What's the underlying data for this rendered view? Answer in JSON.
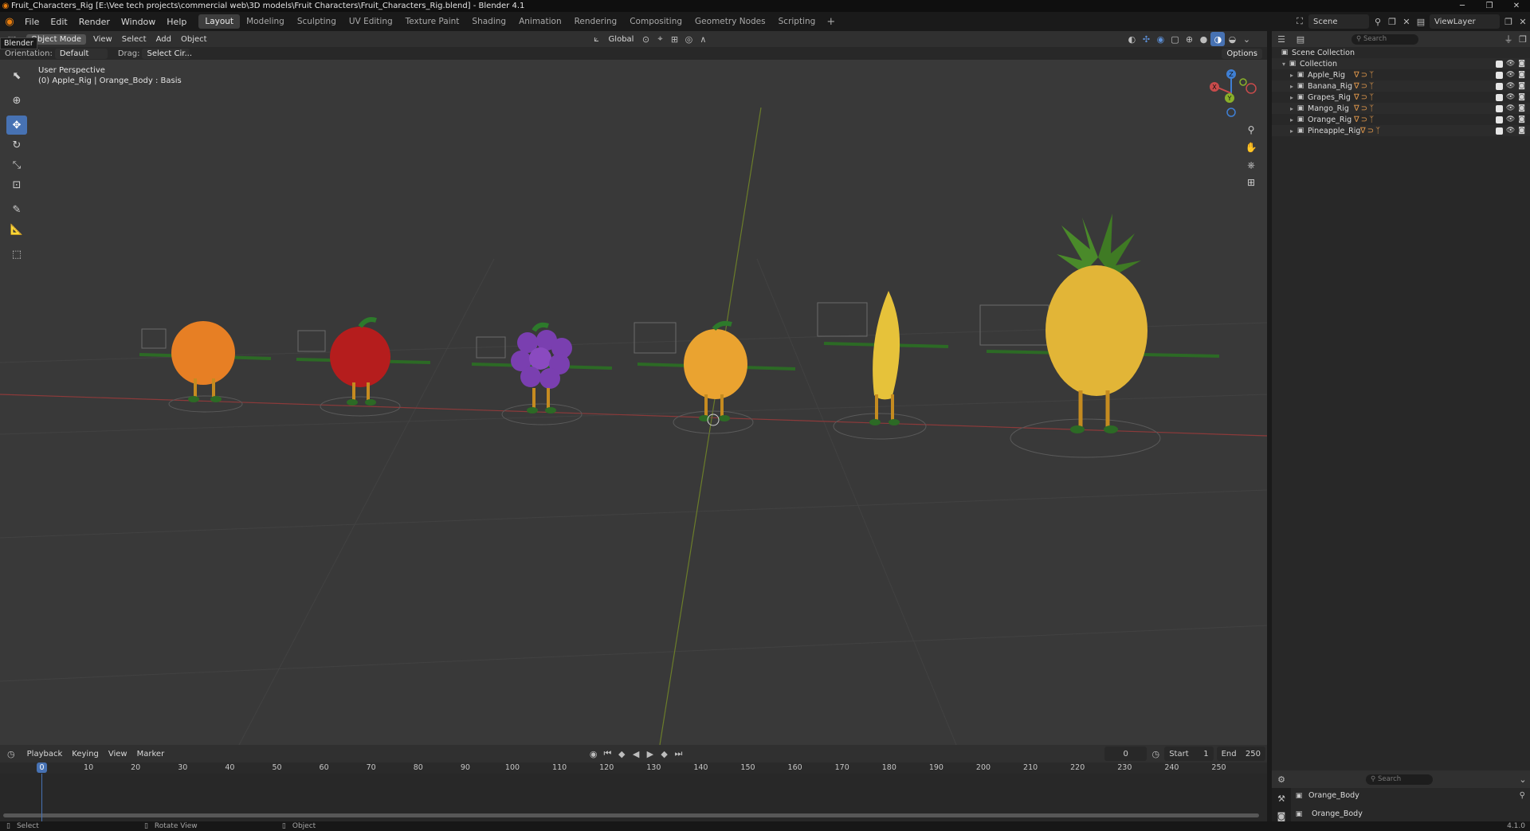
{
  "window": {
    "title": "Fruit_Characters_Rig [E:\\Vee tech projects\\commercial web\\3D models\\Fruit Characters\\Fruit_Characters_Rig.blend] - Blender 4.1",
    "min_icon": "minimize-icon",
    "max_icon": "maximize-icon",
    "close_icon": "close-icon"
  },
  "menubar": {
    "items": [
      "File",
      "Edit",
      "Render",
      "Window",
      "Help"
    ],
    "workspaces": [
      "Layout",
      "Modeling",
      "Sculpting",
      "UV Editing",
      "Texture Paint",
      "Shading",
      "Animation",
      "Rendering",
      "Compositing",
      "Geometry Nodes",
      "Scripting"
    ],
    "active_workspace": "Layout",
    "add_label": "+",
    "scene_label": "Scene",
    "view_layer_label": "ViewLayer"
  },
  "tooltip": "Blender",
  "viewport_header": {
    "mode": "Object Mode",
    "menus": [
      "View",
      "Select",
      "Add",
      "Object"
    ],
    "transform_orientation": "Global",
    "options_label": "Options"
  },
  "viewport_header2": {
    "orientation_label": "Orientation:",
    "orientation_value": "Default",
    "drag_label": "Drag:",
    "drag_value": "Select Cir..."
  },
  "viewport": {
    "perspective_label": "User Perspective",
    "context_label": "(0) Apple_Rig | Orange_Body : Basis",
    "gizmo_axes": {
      "z": "Z",
      "x": "X",
      "y": "Y"
    },
    "colors": {
      "background": "#393939",
      "x_axis": "#c84b4b",
      "y_axis": "#8ab12a",
      "z_axis": "#3f7fd4",
      "active_tool": "#4772b3"
    },
    "characters": [
      {
        "name": "Orange",
        "color": "#e77f24"
      },
      {
        "name": "Apple",
        "color": "#b51d1d"
      },
      {
        "name": "Grapes",
        "color": "#7a3fb0"
      },
      {
        "name": "Orange_Body",
        "color": "#eaa330"
      },
      {
        "name": "Banana",
        "color": "#e6c23a"
      },
      {
        "name": "Pineapple",
        "color": "#e2b537"
      }
    ]
  },
  "timeline": {
    "menus": [
      "Playback",
      "Keying",
      "View",
      "Marker"
    ],
    "current_frame": "0",
    "start_label": "Start",
    "start_value": "1",
    "end_label": "End",
    "end_value": "250",
    "ruler": [
      "0",
      "10",
      "20",
      "30",
      "40",
      "50",
      "60",
      "70",
      "80",
      "90",
      "100",
      "110",
      "120",
      "130",
      "140",
      "150",
      "160",
      "170",
      "180",
      "190",
      "200",
      "210",
      "220",
      "230",
      "240",
      "250"
    ]
  },
  "statusbar": {
    "select": "Select",
    "rotate": "Rotate View",
    "object": "Object",
    "version": "4.1.0"
  },
  "outliner": {
    "search_placeholder": "Search",
    "scene_collection": "Scene Collection",
    "collection": "Collection",
    "items": [
      "Apple_Rig",
      "Banana_Rig",
      "Grapes_Rig",
      "Mango_Rig",
      "Orange_Rig",
      "Pineapple_Rig"
    ]
  },
  "properties": {
    "search_placeholder": "Search",
    "object_name": "Orange_Body",
    "data_name": "Orange_Body"
  }
}
